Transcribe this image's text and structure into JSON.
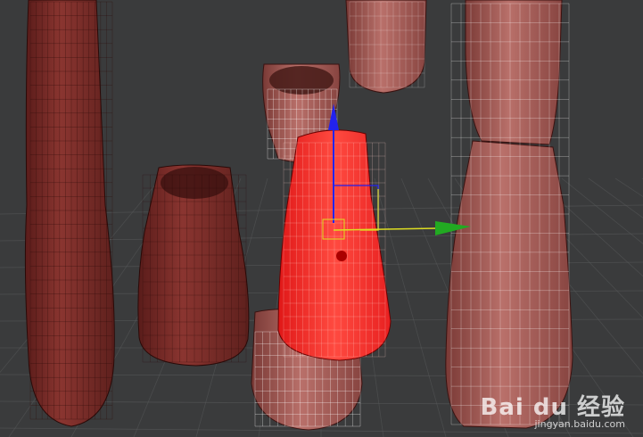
{
  "viewport": {
    "background": "#3a3b3c",
    "grid_color": "#5a5c5d",
    "mesh_color": "#7a2a26",
    "mesh_color_light": "#a65a55",
    "selected_color": "#ff3030",
    "wire_color": "#ffffff",
    "objects": [
      {
        "name": "left-pillar",
        "selected": false
      },
      {
        "name": "top-mid-cap",
        "selected": false
      },
      {
        "name": "top-center-cup",
        "selected": false
      },
      {
        "name": "mid-left-cup",
        "selected": false
      },
      {
        "name": "selected-center-cup",
        "selected": true
      },
      {
        "name": "bottom-center-cup",
        "selected": false
      },
      {
        "name": "right-figure",
        "selected": false
      }
    ]
  },
  "gizmo": {
    "x_axis_color": "#22aa22",
    "y_axis_color": "#2222ee",
    "plane_color": "#dddd22",
    "icon": "move-gizmo-icon"
  },
  "watermark": {
    "brand": "Bai du 经验",
    "site": "jingyan.baidu.com"
  }
}
